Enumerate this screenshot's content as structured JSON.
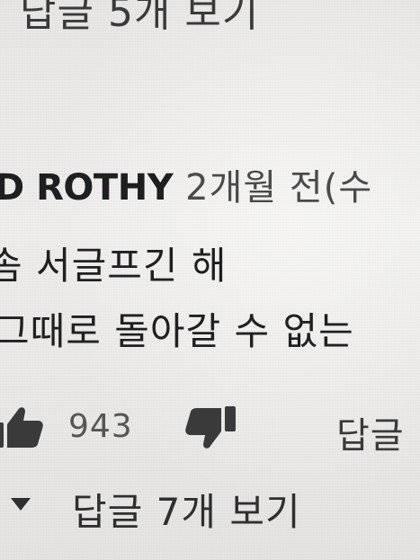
{
  "previous_replies": {
    "label": "답글 5개 보기"
  },
  "comment": {
    "author": "D ROTHY",
    "timestamp": "2개월 전(수",
    "lines": [
      "솜 서글프긴 해",
      "그때로 돌아갈 수 없는"
    ]
  },
  "actions": {
    "like_icon": "thumbs-up-icon",
    "like_count": "943",
    "dislike_icon": "thumbs-down-icon",
    "reply_label": "답글"
  },
  "replies": {
    "toggle_icon": "caret-down-icon",
    "label": "답글 7개 보기"
  }
}
